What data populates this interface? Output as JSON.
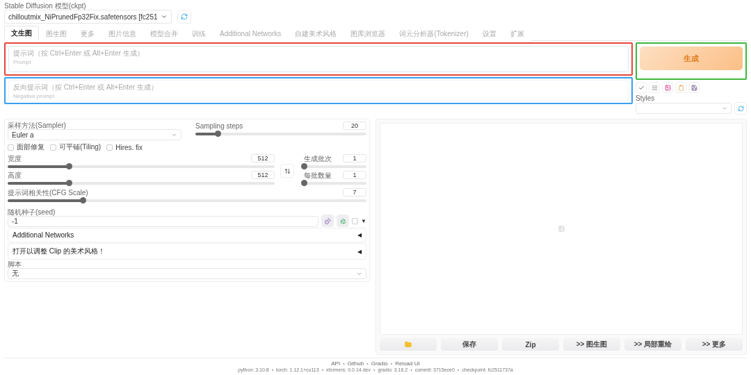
{
  "model": {
    "label": "Stable Diffusion 模型(ckpt)",
    "value": "chilloutmix_NiPrunedFp32Fix.safetensors [fc251"
  },
  "tabs": [
    {
      "label": "文生图",
      "selected": true
    },
    {
      "label": "图生图",
      "selected": false
    },
    {
      "label": "更多",
      "selected": false
    },
    {
      "label": "图片信息",
      "selected": false
    },
    {
      "label": "模型合并",
      "selected": false
    },
    {
      "label": "训练",
      "selected": false
    },
    {
      "label": "Additional Networks",
      "selected": false
    },
    {
      "label": "自建美术风格",
      "selected": false
    },
    {
      "label": "图库浏览器",
      "selected": false
    },
    {
      "label": "词元分析器(Tokenizer)",
      "selected": false
    },
    {
      "label": "设置",
      "selected": false
    },
    {
      "label": "扩展",
      "selected": false
    }
  ],
  "prompt": {
    "label": "提示词（按 Ctrl+Enter 或 Alt+Enter 生成）",
    "placeholder": "Prompt"
  },
  "negative_prompt": {
    "label": "反向提示词（按 Ctrl+Enter 或 Alt+Enter 生成）",
    "placeholder": "Negative prompt"
  },
  "generate": {
    "label": "生成"
  },
  "styles": {
    "label": "Styles"
  },
  "sampler": {
    "label": "采样方法(Sampler)",
    "value": "Euler a"
  },
  "sampling_steps": {
    "label": "Sampling steps",
    "value": "20",
    "level": 0.13
  },
  "checkboxes": [
    {
      "label": "面部修复",
      "checked": false
    },
    {
      "label": "可平铺(Tiling)",
      "checked": false
    },
    {
      "label": "Hires. fix",
      "checked": false
    }
  ],
  "width": {
    "label": "宽度",
    "value": "512",
    "level": 0.23
  },
  "height": {
    "label": "高度",
    "value": "512",
    "level": 0.23
  },
  "batch_count": {
    "label": "生成批次",
    "value": "1",
    "level": 0
  },
  "batch_size": {
    "label": "每批数量",
    "value": "1",
    "level": 0
  },
  "cfg_scale": {
    "label": "提示词相关性(CFG Scale)",
    "value": "7",
    "level": 0.21
  },
  "seed": {
    "label": "随机种子(seed)",
    "value": "-1",
    "extra_checked": false,
    "extra_caret": "▼"
  },
  "accordions": [
    {
      "label": "Additional Networks",
      "expanded": false,
      "marker": "◀"
    },
    {
      "label": "打开以调整 Clip 的美术风格！",
      "expanded": false,
      "marker": "◀"
    }
  ],
  "script": {
    "label": "脚本",
    "value": "无"
  },
  "gallery_buttons": [
    {
      "kind": "icon"
    },
    {
      "kind": "text",
      "label": "保存"
    },
    {
      "kind": "text",
      "label": "Zip"
    },
    {
      "kind": "text",
      "label": ">> 图生图"
    },
    {
      "kind": "text",
      "label": ">> 局部重绘"
    },
    {
      "kind": "text",
      "label": ">> 更多"
    }
  ],
  "footer": {
    "separator": "•",
    "links": [
      "API",
      "Github",
      "Gradio",
      "Reload UI"
    ],
    "versions": [
      "python: 3.10.8",
      "torch: 1.12.1+cu113",
      "xformers: 0.0.14.dev",
      "gradio: 3.16.2",
      "commit: 3715ece0",
      "checkpoint: fc2511737a"
    ]
  }
}
